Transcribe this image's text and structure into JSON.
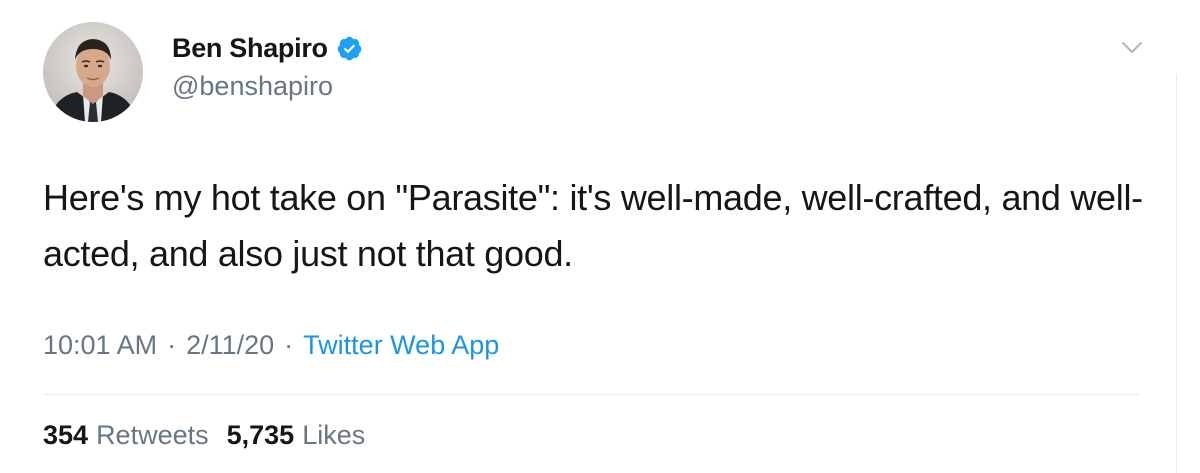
{
  "author": {
    "name": "Ben Shapiro",
    "handle": "@benshapiro",
    "verified": true
  },
  "tweet": {
    "text": "Here's my hot take on \"Parasite\": it's well-made, well-crafted, and well-acted, and also just not that good.",
    "time": "10:01 AM",
    "date": "2/11/20",
    "separator": "·",
    "source": "Twitter Web App"
  },
  "stats": {
    "retweets_count": "354",
    "retweets_label": "Retweets",
    "likes_count": "5,735",
    "likes_label": "Likes"
  },
  "icons": {
    "verified": "verified-badge-icon",
    "menu": "chevron-down-icon"
  },
  "colors": {
    "verified_blue": "#1da1f2",
    "link_blue": "#1b95e0",
    "secondary_text": "#657786"
  }
}
